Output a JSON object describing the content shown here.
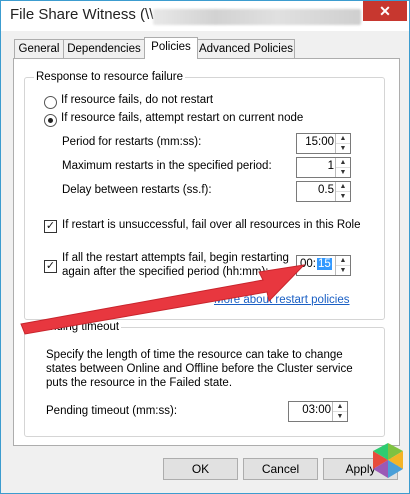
{
  "window": {
    "title": "File Share Witness (\\\\",
    "close_glyph": "✕"
  },
  "tabs": [
    "General",
    "Dependencies",
    "Policies",
    "Advanced Policies"
  ],
  "active_tab": "Policies",
  "failure_group": {
    "legend": "Response to resource failure",
    "no_restart_label": "If resource fails, do not restart",
    "restart_label": "If resource fails, attempt restart on current node",
    "selected": "restart",
    "period_label": "Period for restarts (mm:ss):",
    "period_value": "15:00",
    "max_restarts_label": "Maximum restarts in the specified period:",
    "max_restarts_value": "1",
    "delay_label": "Delay between restarts (ss.f):",
    "delay_value": "0.5",
    "failover_label": "If restart is unsuccessful, fail over all resources in this Role",
    "failover_checked": true,
    "begin_restart_label_1": "If all the restart attempts fail, begin restarting",
    "begin_restart_label_2": "again after the specified period (hh:mm):",
    "begin_restart_checked": true,
    "begin_restart_hours": "00:",
    "begin_restart_minutes": "15",
    "more_link": "More about restart policies"
  },
  "pending_group": {
    "legend": "Pending timeout",
    "description": "Specify the length of time the resource can take to change states between Online and Offline before the Cluster service puts the resource in the Failed state.",
    "timeout_label": "Pending timeout (mm:ss):",
    "timeout_value": "03:00"
  },
  "buttons": {
    "ok": "OK",
    "cancel": "Cancel",
    "apply": "Apply"
  },
  "colors": {
    "arrow": "#e8373f",
    "link": "#1a5fc4",
    "title_border": "#3c9ccf"
  },
  "icons": {
    "arrow": "red-annotation-arrow",
    "watermark": "colored-hexagon-logo"
  }
}
